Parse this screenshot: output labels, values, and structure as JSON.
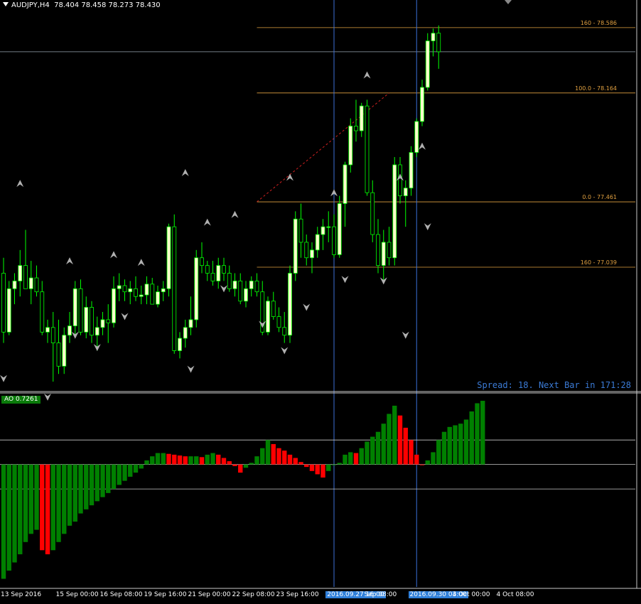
{
  "header": {
    "symbol": "AUDJPY,H4",
    "ohlc": "78.404 78.458 78.273 78.430"
  },
  "spread_text": "Spread: 18. Next Bar in 171:28",
  "indicator": {
    "label": "AO 0.7261"
  },
  "fib_levels": [
    {
      "label": "160  -  78.586",
      "price": 78.586
    },
    {
      "label": "100.0  -  78.164",
      "price": 78.164
    },
    {
      "label": "0.0  -  77.461",
      "price": 77.461
    },
    {
      "label": "160  -  77.039",
      "price": 77.039
    }
  ],
  "x_labels": [
    {
      "text": "13 Sep 2016",
      "bar": 0,
      "highlight": false
    },
    {
      "text": "15 Sep 00:00",
      "bar": 10,
      "highlight": false
    },
    {
      "text": "16 Sep 08:00",
      "bar": 18,
      "highlight": false
    },
    {
      "text": "19 Sep 16:00",
      "bar": 26,
      "highlight": false
    },
    {
      "text": "21 Sep 00:00",
      "bar": 34,
      "highlight": false
    },
    {
      "text": "22 Sep 08:00",
      "bar": 42,
      "highlight": false
    },
    {
      "text": "23 Sep 16:00",
      "bar": 50,
      "highlight": false
    },
    {
      "text": "2016.09.27 16:00",
      "bar": 59,
      "highlight": true
    },
    {
      "text": "Sep 08:00",
      "bar": 66,
      "highlight": false
    },
    {
      "text": "2016.09.30 04:00",
      "bar": 74,
      "highlight": true
    },
    {
      "text": "3 Oct 00:00",
      "bar": 82,
      "highlight": false
    },
    {
      "text": "4 Oct 08:00",
      "bar": 90,
      "highlight": false
    }
  ],
  "colors": {
    "bull_fill": "#ffffcc",
    "bear_fill": "#000000",
    "candle_line": "#00ff00",
    "ao_up": "#008000",
    "ao_down": "#ff0000",
    "fib": "#e0a040",
    "vline": "#3b6fd6",
    "fractal": "#b0b0b0"
  },
  "chart_data": {
    "type": "candlestick",
    "price_range": [
      76.25,
      78.7
    ],
    "ao_range": [
      -1.5,
      0.85
    ],
    "ao_levels": [
      0.3,
      0.0,
      -0.3
    ],
    "vertical_markers_bar": [
      60,
      75
    ],
    "fib_trend_line": {
      "from_bar": 46,
      "from_price": 77.461,
      "to_bar": 70,
      "to_price": 78.164
    },
    "candles": [
      [
        77.0,
        77.1,
        76.55,
        76.62
      ],
      [
        76.62,
        76.95,
        76.6,
        76.9
      ],
      [
        76.9,
        77.0,
        76.8,
        76.95
      ],
      [
        76.95,
        77.15,
        76.85,
        77.05
      ],
      [
        77.05,
        77.28,
        76.9,
        76.9
      ],
      [
        76.9,
        77.08,
        76.8,
        76.97
      ],
      [
        76.97,
        77.05,
        76.85,
        76.88
      ],
      [
        76.88,
        76.95,
        76.6,
        76.62
      ],
      [
        76.62,
        76.7,
        76.55,
        76.65
      ],
      [
        76.65,
        76.75,
        76.3,
        76.55
      ],
      [
        76.55,
        76.7,
        76.35,
        76.4
      ],
      [
        76.4,
        76.65,
        76.35,
        76.6
      ],
      [
        76.6,
        76.75,
        76.55,
        76.66
      ],
      [
        76.66,
        76.95,
        76.6,
        76.9
      ],
      [
        76.9,
        76.96,
        76.6,
        76.62
      ],
      [
        76.62,
        76.85,
        76.58,
        76.78
      ],
      [
        76.78,
        76.82,
        76.55,
        76.6
      ],
      [
        76.6,
        76.72,
        76.5,
        76.65
      ],
      [
        76.65,
        76.75,
        76.6,
        76.7
      ],
      [
        76.7,
        76.8,
        76.55,
        76.68
      ],
      [
        76.68,
        76.98,
        76.65,
        76.9
      ],
      [
        76.9,
        77.0,
        76.82,
        76.92
      ],
      [
        76.92,
        76.96,
        76.82,
        76.88
      ],
      [
        76.88,
        76.95,
        76.8,
        76.9
      ],
      [
        76.9,
        76.98,
        76.82,
        76.85
      ],
      [
        76.85,
        76.92,
        76.8,
        76.86
      ],
      [
        76.86,
        76.98,
        76.8,
        76.93
      ],
      [
        76.93,
        76.97,
        76.8,
        76.8
      ],
      [
        76.8,
        76.92,
        76.78,
        76.88
      ],
      [
        76.88,
        76.95,
        76.82,
        76.9
      ],
      [
        76.9,
        77.32,
        76.85,
        77.3
      ],
      [
        77.3,
        77.38,
        76.48,
        76.5
      ],
      [
        76.5,
        76.62,
        76.45,
        76.58
      ],
      [
        76.58,
        76.7,
        76.52,
        76.65
      ],
      [
        76.65,
        76.85,
        76.6,
        76.7
      ],
      [
        76.7,
        77.15,
        76.65,
        77.1
      ],
      [
        77.1,
        77.2,
        77.0,
        77.05
      ],
      [
        77.05,
        77.08,
        76.95,
        77.0
      ],
      [
        77.0,
        77.08,
        76.92,
        76.95
      ],
      [
        76.95,
        77.1,
        76.9,
        77.05
      ],
      [
        77.05,
        77.1,
        76.95,
        77.0
      ],
      [
        77.0,
        77.05,
        76.88,
        76.9
      ],
      [
        76.9,
        77.0,
        76.85,
        76.95
      ],
      [
        76.95,
        77.0,
        76.8,
        76.82
      ],
      [
        76.82,
        76.95,
        76.78,
        76.9
      ],
      [
        76.9,
        76.98,
        76.85,
        76.95
      ],
      [
        76.95,
        77.0,
        76.85,
        76.88
      ],
      [
        76.88,
        76.95,
        76.6,
        76.62
      ],
      [
        76.62,
        76.85,
        76.6,
        76.82
      ],
      [
        76.82,
        76.88,
        76.7,
        76.72
      ],
      [
        76.72,
        76.78,
        76.62,
        76.65
      ],
      [
        76.65,
        76.75,
        76.55,
        76.6
      ],
      [
        76.6,
        77.05,
        76.55,
        77.0
      ],
      [
        77.0,
        77.4,
        76.95,
        77.35
      ],
      [
        77.35,
        77.45,
        77.1,
        77.2
      ],
      [
        77.2,
        77.25,
        77.05,
        77.1
      ],
      [
        77.1,
        77.2,
        77.0,
        77.15
      ],
      [
        77.15,
        77.3,
        77.1,
        77.25
      ],
      [
        77.25,
        77.35,
        77.15,
        77.3
      ],
      [
        77.3,
        77.4,
        77.2,
        77.3
      ],
      [
        77.3,
        77.38,
        77.1,
        77.12
      ],
      [
        77.12,
        77.5,
        77.1,
        77.45
      ],
      [
        77.45,
        77.72,
        77.3,
        77.7
      ],
      [
        77.7,
        78.0,
        77.65,
        77.95
      ],
      [
        77.95,
        78.12,
        77.85,
        77.92
      ],
      [
        77.92,
        78.1,
        77.88,
        78.08
      ],
      [
        78.08,
        78.12,
        77.5,
        77.52
      ],
      [
        77.52,
        77.6,
        77.2,
        77.25
      ],
      [
        77.25,
        77.35,
        77.0,
        77.05
      ],
      [
        77.05,
        77.28,
        76.95,
        77.2
      ],
      [
        77.2,
        77.3,
        77.05,
        77.1
      ],
      [
        77.1,
        77.75,
        77.05,
        77.7
      ],
      [
        77.7,
        77.75,
        77.45,
        77.5
      ],
      [
        77.5,
        77.6,
        77.3,
        77.55
      ],
      [
        77.55,
        77.82,
        77.5,
        77.78
      ],
      [
        77.78,
        78.0,
        77.75,
        77.98
      ],
      [
        77.98,
        78.25,
        77.95,
        78.2
      ],
      [
        78.2,
        78.55,
        78.18,
        78.5
      ],
      [
        78.5,
        78.58,
        78.4,
        78.55
      ],
      [
        78.55,
        78.6,
        78.32,
        78.43
      ]
    ],
    "ao": [
      -1.4,
      -1.3,
      -1.2,
      -1.1,
      -0.95,
      -0.85,
      -0.8,
      -1.05,
      -1.1,
      -1.05,
      -0.95,
      -0.85,
      -0.75,
      -0.7,
      -0.6,
      -0.55,
      -0.5,
      -0.45,
      -0.4,
      -0.35,
      -0.3,
      -0.25,
      -0.2,
      -0.15,
      -0.1,
      -0.05,
      0.05,
      0.1,
      0.14,
      0.14,
      0.13,
      0.12,
      0.11,
      0.1,
      0.1,
      0.1,
      0.09,
      0.12,
      0.14,
      0.12,
      0.08,
      0.04,
      -0.02,
      -0.1,
      -0.04,
      0.02,
      0.1,
      0.2,
      0.3,
      0.25,
      0.2,
      0.17,
      0.12,
      0.08,
      0.03,
      -0.03,
      -0.08,
      -0.12,
      -0.16,
      -0.08,
      0.0,
      0.02,
      0.12,
      0.15,
      0.14,
      0.2,
      0.28,
      0.34,
      0.4,
      0.5,
      0.62,
      0.72,
      0.6,
      0.45,
      0.3,
      0.12,
      0.0,
      0.05,
      0.15,
      0.3,
      0.4,
      0.46,
      0.48,
      0.5,
      0.55,
      0.65,
      0.75,
      0.78
    ],
    "fractals_up": [
      [
        3,
        77.58
      ],
      [
        12,
        77.08
      ],
      [
        20,
        77.12
      ],
      [
        25,
        77.07
      ],
      [
        33,
        77.65
      ],
      [
        37,
        77.33
      ],
      [
        42,
        77.38
      ],
      [
        52,
        77.62
      ],
      [
        60,
        77.52
      ],
      [
        66,
        78.28
      ],
      [
        72,
        77.62
      ],
      [
        76,
        77.82
      ]
    ],
    "fractals_down": [
      [
        0,
        76.32
      ],
      [
        8,
        76.2
      ],
      [
        13,
        76.6
      ],
      [
        17,
        76.52
      ],
      [
        22,
        76.72
      ],
      [
        34,
        76.38
      ],
      [
        40,
        76.9
      ],
      [
        47,
        76.67
      ],
      [
        51,
        76.5
      ],
      [
        55,
        76.78
      ],
      [
        62,
        76.96
      ],
      [
        69,
        76.95
      ],
      [
        73,
        76.6
      ],
      [
        77,
        77.3
      ]
    ]
  }
}
